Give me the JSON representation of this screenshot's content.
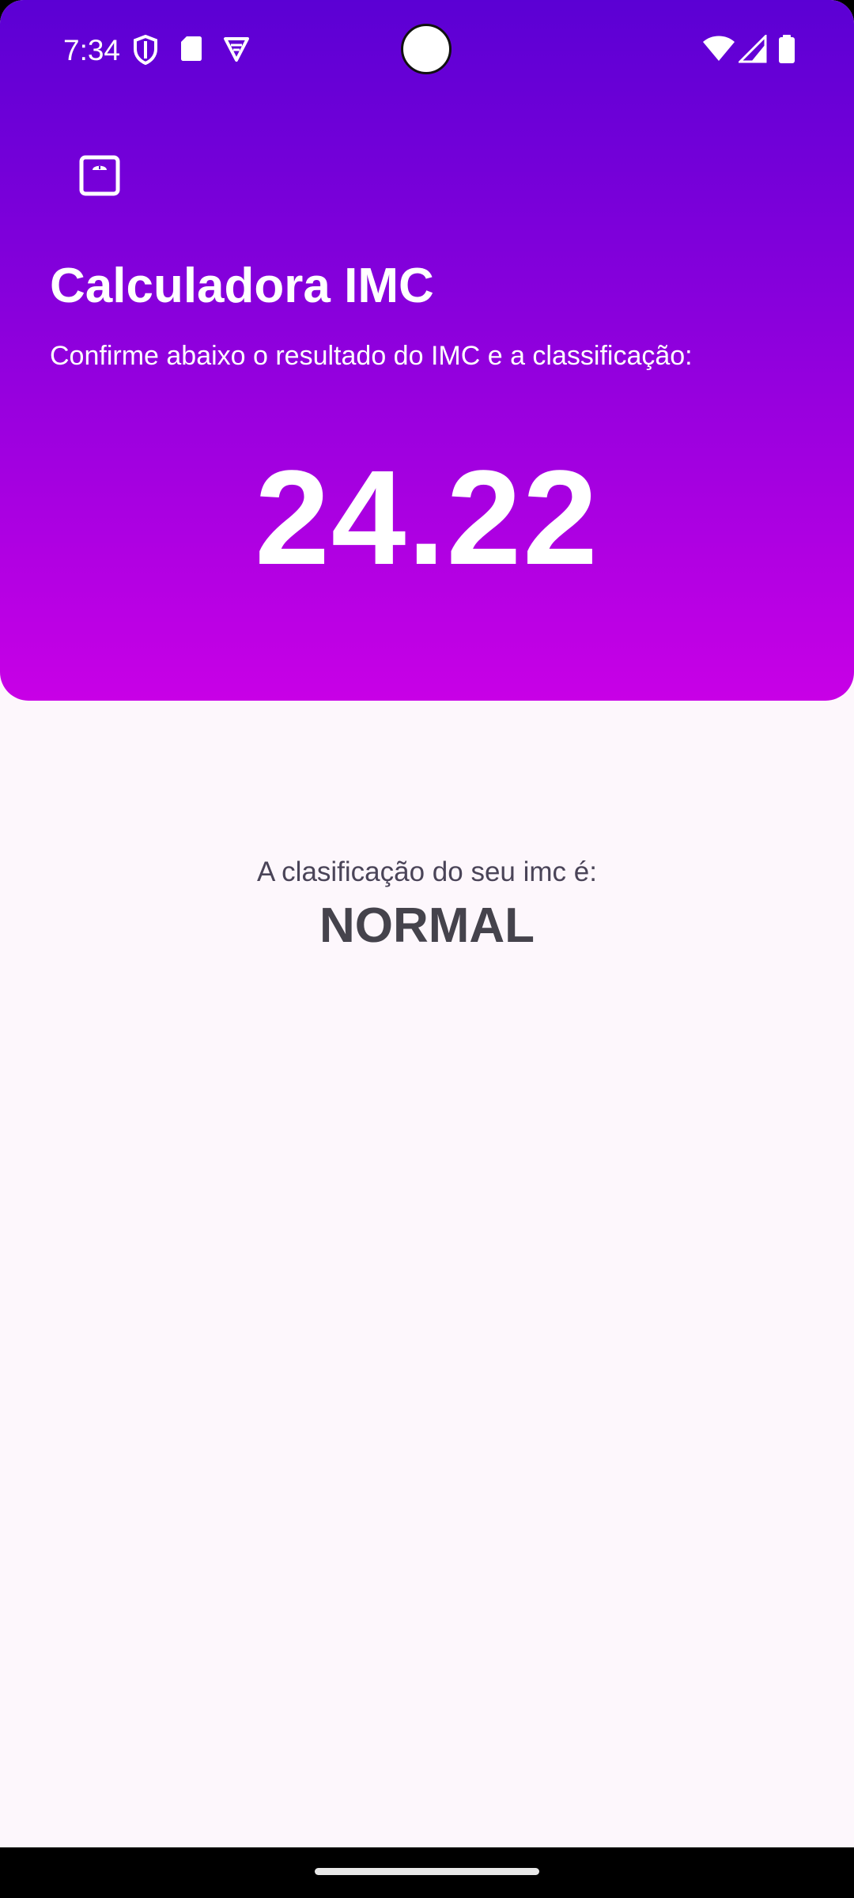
{
  "status_bar": {
    "time": "7:34",
    "left_icons": [
      "shield-icon",
      "sd-card-icon",
      "vpn-shield-icon"
    ],
    "right_icons": [
      "wifi-icon",
      "signal-icon",
      "battery-icon"
    ]
  },
  "header": {
    "icon": "scale-icon",
    "title": "Calculadora IMC",
    "subtitle": "Confirme abaixo o resultado do IMC e a classificação:",
    "result": "24.22",
    "gradient": [
      "#5b00d4",
      "#c800e6"
    ]
  },
  "classification": {
    "label": "A clasificação do seu imc é:",
    "value": "NORMAL"
  },
  "colors": {
    "background": "#fdf7fc",
    "text_dark": "#45434c"
  }
}
